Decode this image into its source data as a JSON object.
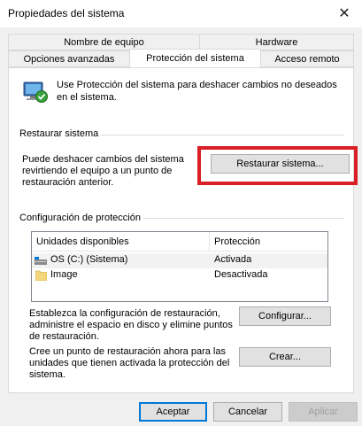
{
  "window": {
    "title": "Propiedades del sistema",
    "close_glyph": "✕"
  },
  "tabs": {
    "row_back": [
      "Nombre de equipo",
      "Hardware"
    ],
    "row_front": [
      "Opciones avanzadas",
      "Protección del sistema",
      "Acceso remoto"
    ],
    "active": "Protección del sistema"
  },
  "intro": "Use Protección del sistema para deshacer cambios no deseados en el sistema.",
  "restore": {
    "group_title": "Restaurar sistema",
    "description": "Puede deshacer cambios del sistema revirtiendo el equipo a un punto de restauración anterior.",
    "button": "Restaurar sistema...",
    "highlight_color": "#d92027"
  },
  "protection": {
    "group_title": "Configuración de protección",
    "columns": [
      "Unidades disponibles",
      "Protección"
    ],
    "drives": [
      {
        "name": "OS (C:) (Sistema)",
        "status": "Activada",
        "icon": "system-drive-icon"
      },
      {
        "name": "Image",
        "status": "Desactivada",
        "icon": "folder-icon"
      }
    ],
    "configure_text": "Establezca la configuración de restauración, administre el espacio en disco y elimine puntos de restauración.",
    "configure_button": "Configurar...",
    "create_text": "Cree un punto de restauración ahora para las unidades que tienen activada la protección del sistema.",
    "create_button": "Crear..."
  },
  "footer": {
    "ok": "Aceptar",
    "cancel": "Cancelar",
    "apply": "Aplicar"
  },
  "colors": {
    "accent": "#0078d7",
    "client_bg": "#f0f0f0"
  }
}
